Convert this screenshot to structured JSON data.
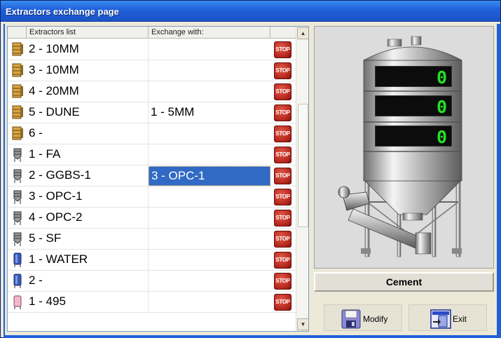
{
  "window": {
    "title": "Extractors exchange page"
  },
  "grid": {
    "headers": {
      "list": "Extractors list",
      "exchange": "Exchange with:"
    },
    "rows": [
      {
        "icon": "bin-icon",
        "name": "2 - 10MM",
        "exchange": ""
      },
      {
        "icon": "bin-icon",
        "name": "3 - 10MM",
        "exchange": ""
      },
      {
        "icon": "bin-icon",
        "name": "4 - 20MM",
        "exchange": ""
      },
      {
        "icon": "bin-icon",
        "name": "5 - DUNE",
        "exchange": "1 - 5MM"
      },
      {
        "icon": "bin-icon",
        "name": "6 -",
        "exchange": ""
      },
      {
        "icon": "silo-icon",
        "name": "1 - FA",
        "exchange": ""
      },
      {
        "icon": "silo-icon",
        "name": "2 - GGBS-1",
        "exchange": "3 - OPC-1",
        "selected": true
      },
      {
        "icon": "silo-icon",
        "name": "3 - OPC-1",
        "exchange": ""
      },
      {
        "icon": "silo-icon",
        "name": "4 - OPC-2",
        "exchange": ""
      },
      {
        "icon": "silo-icon",
        "name": "5 - SF",
        "exchange": ""
      },
      {
        "icon": "water-tank-icon",
        "name": "1 - WATER",
        "exchange": ""
      },
      {
        "icon": "water-tank-icon",
        "name": "2 -",
        "exchange": ""
      },
      {
        "icon": "additive-tank-icon",
        "name": "1 - 495",
        "exchange": ""
      }
    ],
    "stop_label": "STOP"
  },
  "silo": {
    "displays": [
      "0",
      "0",
      "0"
    ],
    "material": "Cement"
  },
  "buttons": {
    "modify": "Modify",
    "exit": "Exit"
  },
  "colors": {
    "selection": "#316AC5",
    "display_digits": "#23E123",
    "titlebar": "#1F5FD8"
  }
}
